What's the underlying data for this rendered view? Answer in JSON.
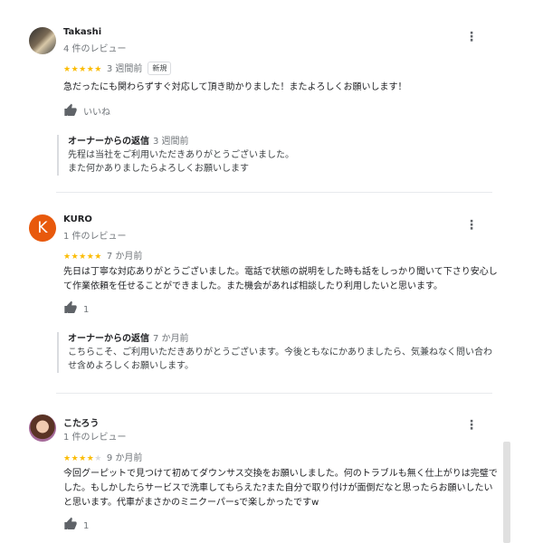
{
  "reviews": [
    {
      "name": "Takashi",
      "review_count": "4 件のレビュー",
      "stars": "★★★★★",
      "stars_empty": "",
      "time": "3 週間前",
      "badge": "新規",
      "text": "急だったにも関わらずすぐ対応して頂き助かりました！またよろしくお願いします！",
      "like_label": "いいね",
      "owner_label": "オーナーからの返信",
      "owner_time": "3 週間前",
      "owner_text": "先程は当社をご利用いただきありがとうございました。\nまた何かありましたらよろしくお願いします",
      "rating": 5
    },
    {
      "name": "KURO",
      "avatar_letter": "K",
      "review_count": "1 件のレビュー",
      "stars": "★★★★★",
      "stars_empty": "",
      "time": "7 か月前",
      "text": "先日は丁寧な対応ありがとうございました。電話で状態の説明をした時も話をしっかり聞いて下さり安心して作業依頼を任せることができました。また機会があれば相談したり利用したいと思います。",
      "like_label": "1",
      "owner_label": "オーナーからの返信",
      "owner_time": "7 か月前",
      "owner_text": "こちらこそ、ご利用いただきありがとうございます。今後ともなにかありましたら、気兼ねなく問い合わせ含めよろしくお願いします。",
      "rating": 5
    },
    {
      "name": "こたろう",
      "review_count": "1 件のレビュー",
      "stars": "★★★★",
      "stars_empty": "★",
      "time": "9 か月前",
      "text": "今回グーピットで見つけて初めてダウンサス交換をお願いしました。何のトラブルも無く仕上がりは完璧でした。もしかしたらサービスで洗車してもらえた?また自分で取り付けが面倒だなと思ったらお願いしたいと思います。代車がまさかのミニクーパーsで楽しかったですw",
      "like_label": "1",
      "rating": 4
    }
  ],
  "colors": {
    "star": "#fbbc04",
    "avatar_k": "#e8590c"
  },
  "icons": {
    "more": "more-vert-icon",
    "like": "thumb-up-icon"
  }
}
